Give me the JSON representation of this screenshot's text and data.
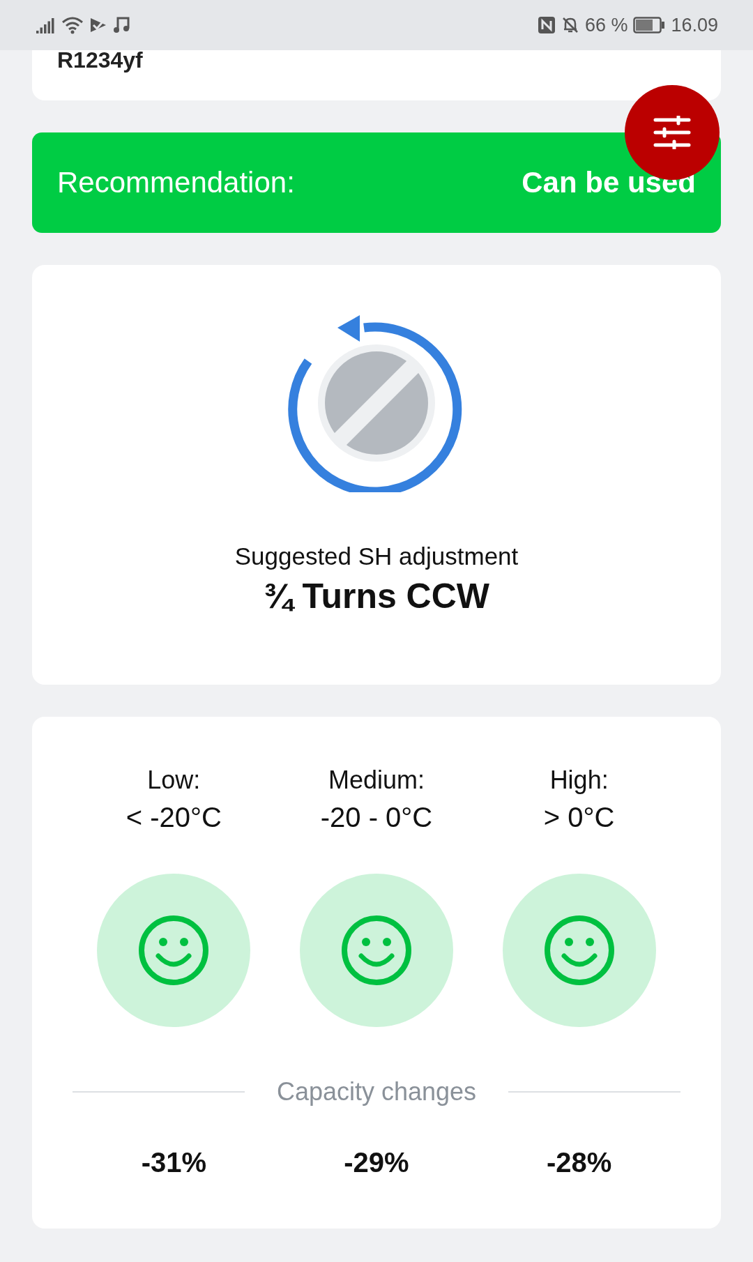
{
  "status_bar": {
    "battery": "66 %",
    "time": "16.09"
  },
  "refrigerant": {
    "name": "R1234yf"
  },
  "recommendation": {
    "label": "Recommendation:",
    "value": "Can be used"
  },
  "adjustment": {
    "caption": "Suggested SH adjustment",
    "value": "¾ Turns CCW"
  },
  "ranges": [
    {
      "label": "Low:",
      "range": "< -20°C",
      "capacity": "-31%"
    },
    {
      "label": "Medium:",
      "range": "-20 - 0°C",
      "capacity": "-29%"
    },
    {
      "label": "High:",
      "range": "> 0°C",
      "capacity": "-28%"
    }
  ],
  "capacity_heading": "Capacity changes"
}
